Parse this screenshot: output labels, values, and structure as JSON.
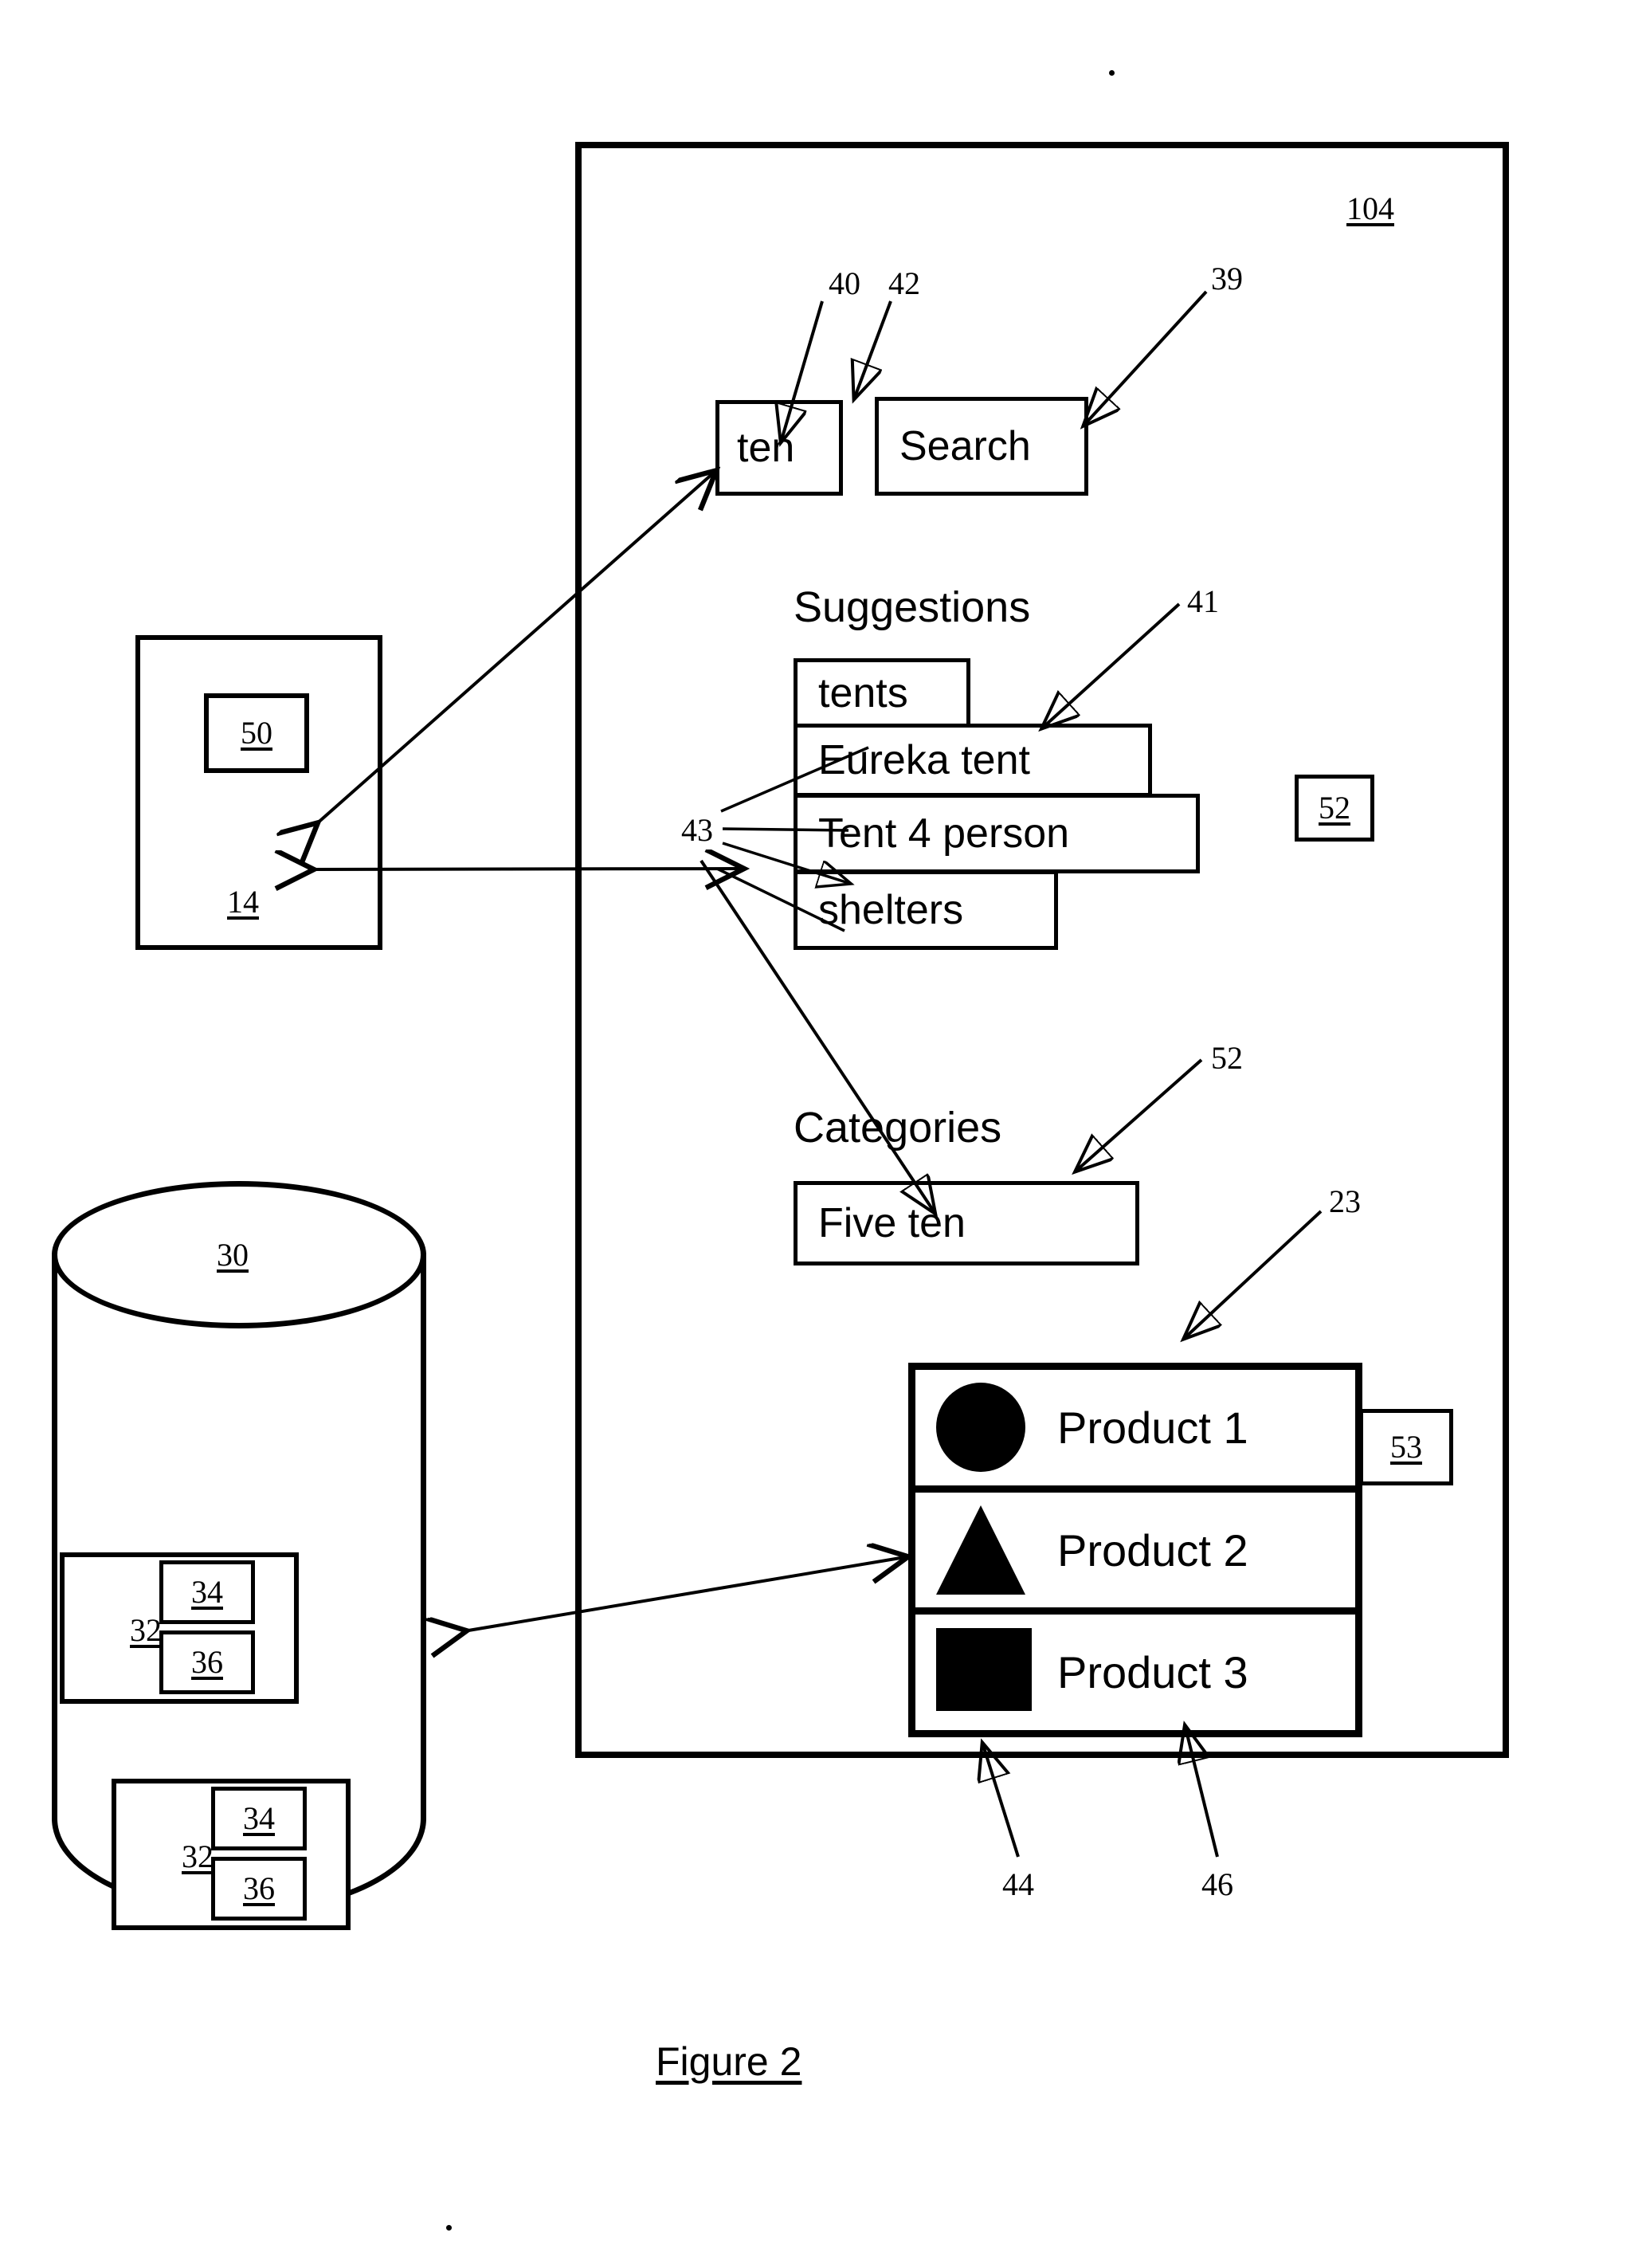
{
  "figure": {
    "caption": "Figure 2",
    "device_ref": "104"
  },
  "search": {
    "query_value": "ten",
    "query_ref": "40",
    "query_ref_alt": "42",
    "search_button_label": "Search",
    "search_button_ref": "39"
  },
  "suggestions": {
    "heading": "Suggestions",
    "ref": "41",
    "group_ref": "43",
    "items": [
      {
        "label": "tents"
      },
      {
        "label": "Eureka tent"
      },
      {
        "label": "Tent 4 person"
      },
      {
        "label": "shelters"
      }
    ]
  },
  "categories": {
    "heading": "Categories",
    "ref": "52",
    "items": [
      {
        "label": "Five ten"
      }
    ]
  },
  "products": {
    "list_ref": "23",
    "badge_ref": "53",
    "image_ref": "44",
    "name_ref": "46",
    "items": [
      {
        "name": "Product 1",
        "thumb": "circle-icon"
      },
      {
        "name": "Product 2",
        "thumb": "triangle-icon"
      },
      {
        "name": "Product 3",
        "thumb": "square-icon"
      }
    ]
  },
  "standalone_badges": {
    "category_module_ref": "52"
  },
  "client_device": {
    "ref": "14",
    "module_ref": "50"
  },
  "database": {
    "ref": "30",
    "records": [
      {
        "ref": "32",
        "fields": [
          {
            "ref": "34"
          },
          {
            "ref": "36"
          }
        ]
      },
      {
        "ref": "32",
        "fields": [
          {
            "ref": "34"
          },
          {
            "ref": "36"
          }
        ]
      }
    ]
  }
}
